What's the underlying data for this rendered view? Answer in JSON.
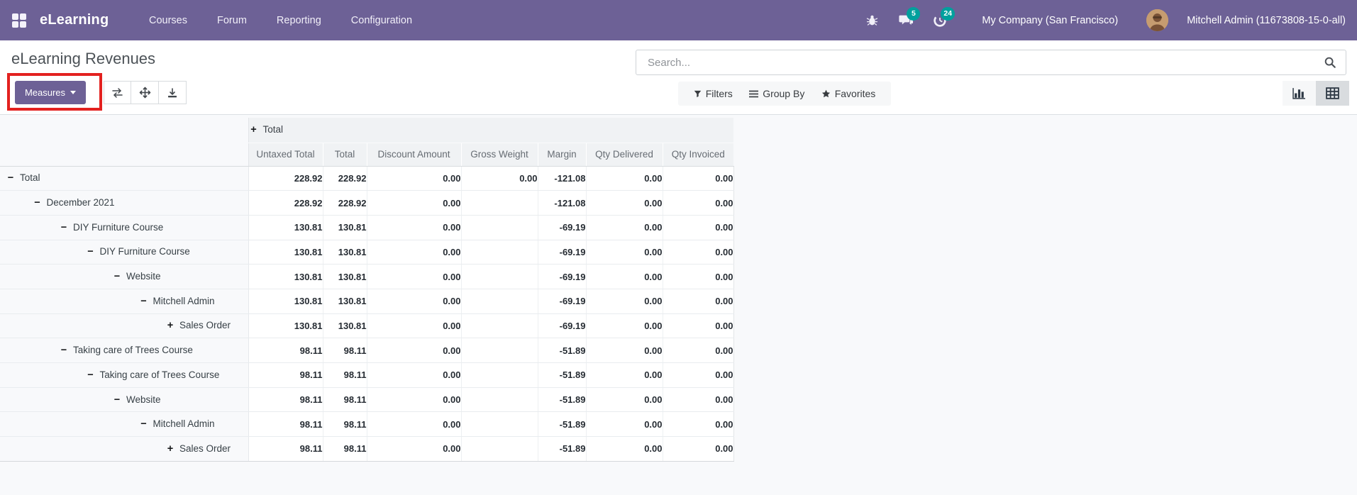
{
  "colors": {
    "accent": "#6d6196",
    "badge": "#00a09d",
    "highlight": "#e3211f"
  },
  "navbar": {
    "app_name": "eLearning",
    "menus": [
      "Courses",
      "Forum",
      "Reporting",
      "Configuration"
    ],
    "messages_badge": "5",
    "activities_badge": "24",
    "company": "My Company (San Francisco)",
    "user": "Mitchell Admin (11673808-15-0-all)"
  },
  "control_panel": {
    "title": "eLearning Revenues",
    "measures_label": "Measures",
    "search_placeholder": "Search...",
    "filters_label": "Filters",
    "group_by_label": "Group By",
    "favorites_label": "Favorites"
  },
  "pivot": {
    "col_group_toggle": "+",
    "col_group_header": "Total",
    "measures": [
      "Untaxed Total",
      "Total",
      "Discount Amount",
      "Gross Weight",
      "Margin",
      "Qty Delivered",
      "Qty Invoiced"
    ],
    "rows": [
      {
        "label": "Total",
        "level": 0,
        "toggle": "−",
        "values": [
          "228.92",
          "228.92",
          "0.00",
          "0.00",
          "-121.08",
          "0.00",
          "0.00"
        ]
      },
      {
        "label": "December 2021",
        "level": 1,
        "toggle": "−",
        "values": [
          "228.92",
          "228.92",
          "0.00",
          "",
          "-121.08",
          "0.00",
          "0.00"
        ]
      },
      {
        "label": "DIY Furniture Course",
        "level": 2,
        "toggle": "−",
        "values": [
          "130.81",
          "130.81",
          "0.00",
          "",
          "-69.19",
          "0.00",
          "0.00"
        ]
      },
      {
        "label": "DIY Furniture Course",
        "level": 3,
        "toggle": "−",
        "values": [
          "130.81",
          "130.81",
          "0.00",
          "",
          "-69.19",
          "0.00",
          "0.00"
        ]
      },
      {
        "label": "Website",
        "level": 4,
        "toggle": "−",
        "values": [
          "130.81",
          "130.81",
          "0.00",
          "",
          "-69.19",
          "0.00",
          "0.00"
        ]
      },
      {
        "label": "Mitchell Admin",
        "level": 5,
        "toggle": "−",
        "values": [
          "130.81",
          "130.81",
          "0.00",
          "",
          "-69.19",
          "0.00",
          "0.00"
        ]
      },
      {
        "label": "Sales Order",
        "level": 6,
        "toggle": "+",
        "values": [
          "130.81",
          "130.81",
          "0.00",
          "",
          "-69.19",
          "0.00",
          "0.00"
        ]
      },
      {
        "label": "Taking care of Trees Course",
        "level": 2,
        "toggle": "−",
        "values": [
          "98.11",
          "98.11",
          "0.00",
          "",
          "-51.89",
          "0.00",
          "0.00"
        ]
      },
      {
        "label": "Taking care of Trees Course",
        "level": 3,
        "toggle": "−",
        "values": [
          "98.11",
          "98.11",
          "0.00",
          "",
          "-51.89",
          "0.00",
          "0.00"
        ]
      },
      {
        "label": "Website",
        "level": 4,
        "toggle": "−",
        "values": [
          "98.11",
          "98.11",
          "0.00",
          "",
          "-51.89",
          "0.00",
          "0.00"
        ]
      },
      {
        "label": "Mitchell Admin",
        "level": 5,
        "toggle": "−",
        "values": [
          "98.11",
          "98.11",
          "0.00",
          "",
          "-51.89",
          "0.00",
          "0.00"
        ]
      },
      {
        "label": "Sales Order",
        "level": 6,
        "toggle": "+",
        "values": [
          "98.11",
          "98.11",
          "0.00",
          "",
          "-51.89",
          "0.00",
          "0.00"
        ]
      }
    ]
  }
}
